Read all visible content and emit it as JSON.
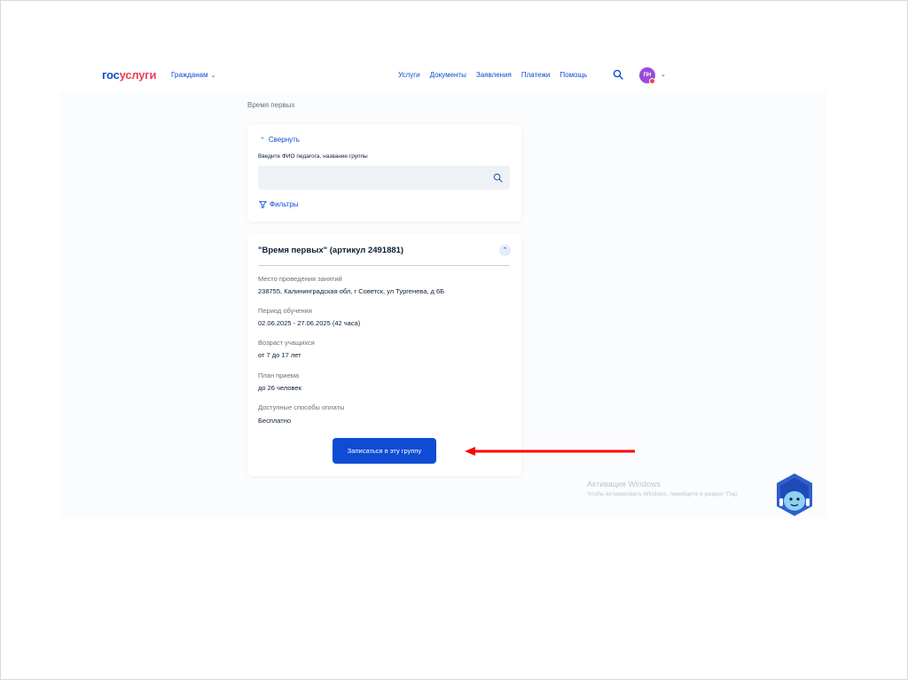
{
  "header": {
    "logo_part1": "гос",
    "logo_part2": "услуги",
    "audience_menu": "Гражданам",
    "nav": [
      "Услуги",
      "Документы",
      "Заявления",
      "Платежи",
      "Помощь"
    ],
    "avatar_initials": "ПН"
  },
  "breadcrumb": "Время первых",
  "filter_panel": {
    "collapse_label": "Свернуть",
    "search_label": "Введите ФИО педагога, название группы",
    "search_placeholder": "",
    "filters_label": "Фильтры"
  },
  "group_card": {
    "title": "\"Время первых\" (артикул 2491881)",
    "fields": [
      {
        "label": "Место проведения занятий",
        "value": "238755, Калининградская обл, г Советск, ул Тургенева, д 6Б"
      },
      {
        "label": "Период обучения",
        "value": "02.06.2025 - 27.06.2025 (42 часа)"
      },
      {
        "label": "Возраст учащихся",
        "value": "от 7 до 17 лет"
      },
      {
        "label": "План приема",
        "value": "до 26 человек"
      },
      {
        "label": "Доступные способы оплаты",
        "value": "Бесплатно"
      }
    ],
    "enroll_button": "Записаться в эту группу"
  },
  "windows_watermark": {
    "title": "Активация Windows",
    "subtitle": "Чтобы активировать Windows, перейдите в раздел \"Пар"
  },
  "colors": {
    "brand_blue": "#0d4cd3",
    "brand_red": "#ee3f58",
    "annotation_arrow": "#ff0000",
    "avatar": "#9b4bd8"
  },
  "icons": [
    "search-icon",
    "chevron-down-icon",
    "chevron-up-icon",
    "filter-icon",
    "assistant-robot-icon",
    "arrow-annotation"
  ]
}
